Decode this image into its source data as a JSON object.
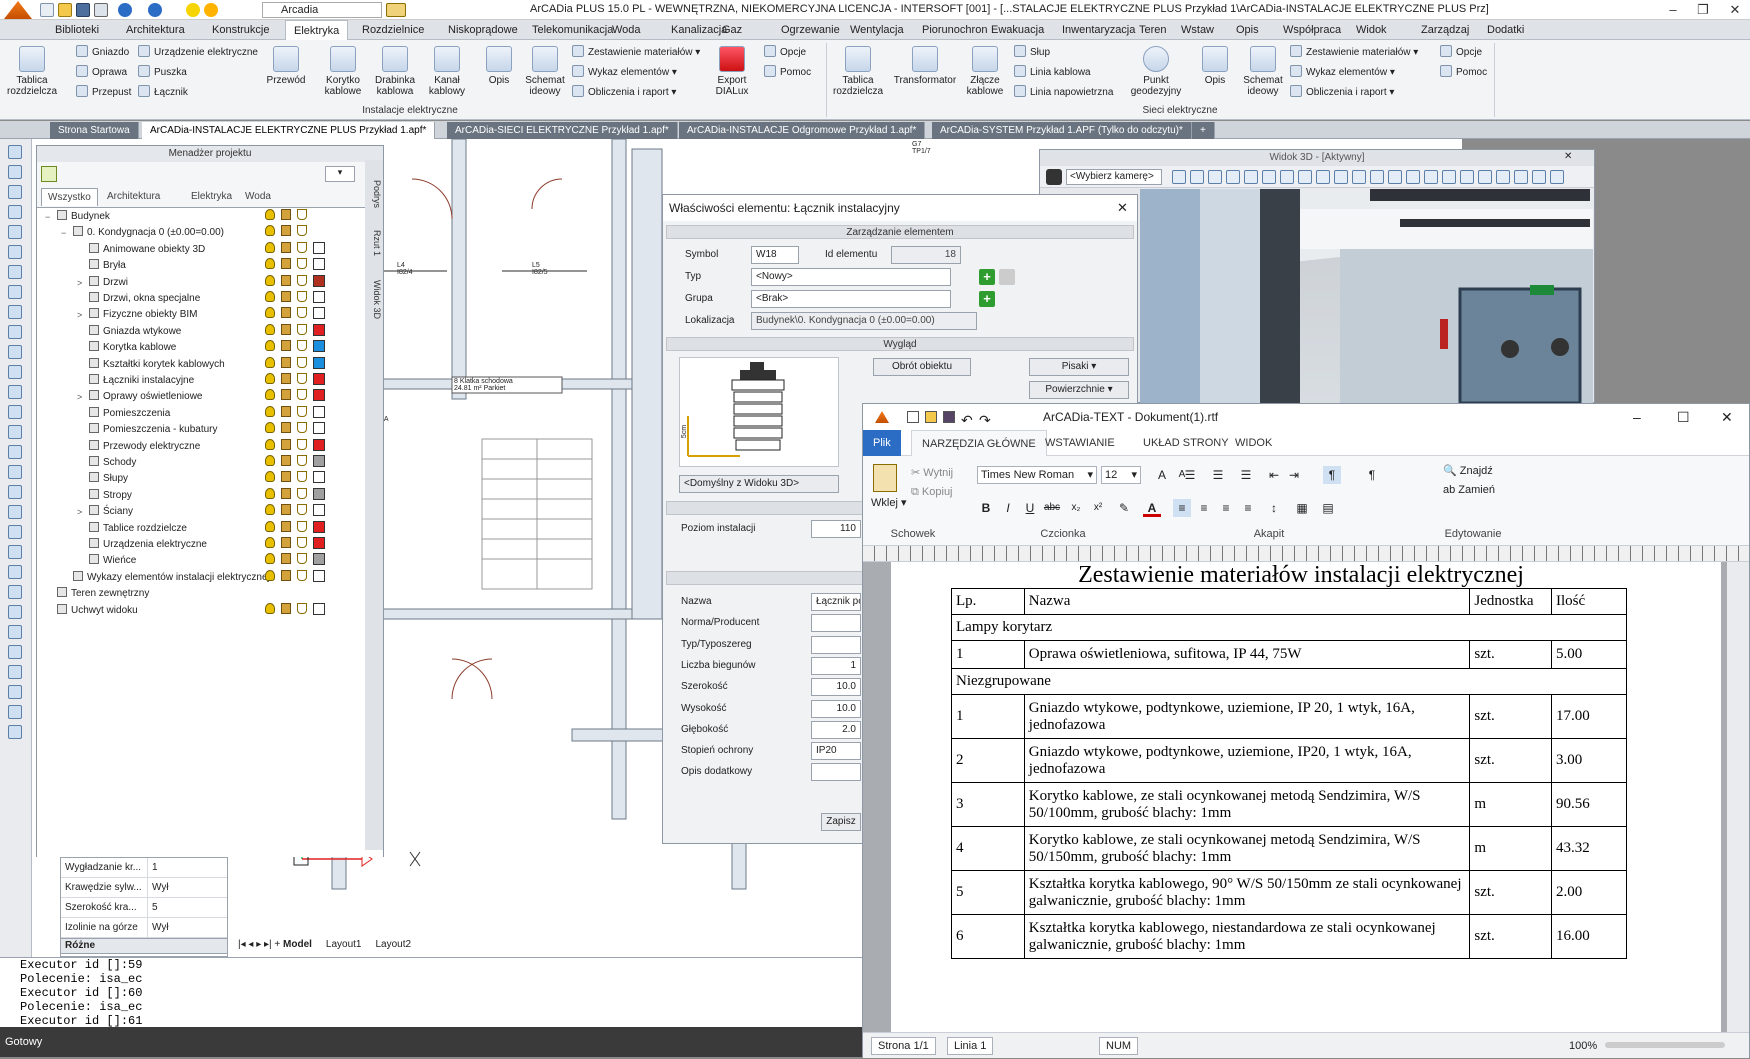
{
  "titlebar": {
    "title": "ArCADia PLUS 15.0 PL - WEWNĘTRZNA, NIEKOMERCYJNA LICENCJA - INTERSOFT [001] - [...STALACJE ELEKTRYCZNE PLUS Przykład 1\\ArCADia-INSTALACJE ELEKTRYCZNE PLUS Prz]",
    "layer_select": "Arcadia"
  },
  "menu": [
    "Biblioteki",
    "Architektura",
    "Konstrukcje",
    "Elektryka",
    "Rozdzielnice",
    "Niskoprądowe",
    "Telekomunikacja",
    "Woda",
    "Kanalizacja",
    "Gaz",
    "Ogrzewanie",
    "Wentylacja",
    "Piorunochron",
    "Ewakuacja",
    "Inwentaryzacja",
    "Teren",
    "Wstaw",
    "Opis",
    "Współpraca",
    "Widok",
    "Zarządzaj",
    "Dodatki"
  ],
  "menu_active": "Elektryka",
  "ribbon": {
    "tablica": "Tablica rozdzielcza",
    "gniazdo": "Gniazdo",
    "urzadzenie": "Urządzenie elektryczne",
    "oprawa": "Oprawa",
    "puszka": "Puszka",
    "przepust": "Przepust",
    "lacznik": "Łącznik",
    "przewod": "Przewód",
    "korytko": "Korytko kablowe",
    "drabinka": "Drabinka kablowa",
    "kanal": "Kanał kablowy",
    "opis": "Opis",
    "schemat": "Schemat ideowy",
    "zestawienie": "Zestawienie materiałów",
    "wykaz": "Wykaz elementów",
    "obliczenia": "Obliczenia i raport",
    "export": "Export DIALux",
    "opcje": "Opcje",
    "pomoc": "Pomoc",
    "group_instalacje": "Instalacje elektryczne",
    "tablica2": "Tablica rozdzielcza",
    "transformator": "Transformator",
    "zlacze": "Złącze kablowe",
    "slup": "Słup",
    "linia_kablowa": "Linia kablowa",
    "linia_napowietrzna": "Linia napowietrzna",
    "punkt": "Punkt geodezyjny",
    "opis2": "Opis",
    "schemat2": "Schemat ideowy",
    "zestawienie2": "Zestawienie materiałów",
    "wykaz2": "Wykaz elementów",
    "obliczenia2": "Obliczenia i raport",
    "opcje2": "Opcje",
    "pomoc2": "Pomoc",
    "group_sieci": "Sieci elektryczne"
  },
  "doc_tabs": [
    {
      "label": "Strona Startowa",
      "active": false
    },
    {
      "label": "ArCADia-INSTALACJE ELEKTRYCZNE PLUS Przykład 1.apf*",
      "active": true
    },
    {
      "label": "ArCADia-SIECI ELEKTRYCZNE Przykład 1.apf*",
      "active": false
    },
    {
      "label": "ArCADia-INSTALACJE Odgromowe Przykład 1.apf*",
      "active": false
    },
    {
      "label": "ArCADia-SYSTEM Przykład 1.APF (Tylko do odczytu)*",
      "active": false
    }
  ],
  "project_manager": {
    "title": "Menadżer projektu",
    "tabs": [
      "Wszystko",
      "Architektura",
      "Elektryka",
      "Woda"
    ],
    "side_tabs": [
      "Podrys",
      "Rzut 1",
      "Widok 3D"
    ],
    "tree": [
      {
        "label": "Budynek",
        "level": 0,
        "expand": "−",
        "color": ""
      },
      {
        "label": "0. Kondygnacja 0 (±0.00=0.00)",
        "level": 1,
        "expand": "−",
        "color": ""
      },
      {
        "label": "Animowane obiekty 3D",
        "level": 2,
        "expand": "",
        "color": "#ffffff"
      },
      {
        "label": "Bryła",
        "level": 2,
        "expand": "",
        "color": "#ffffff"
      },
      {
        "label": "Drzwi",
        "level": 2,
        "expand": ">",
        "color": "#b03020"
      },
      {
        "label": "Drzwi, okna specjalne",
        "level": 2,
        "expand": "",
        "color": "#ffffff"
      },
      {
        "label": "Fizyczne obiekty BIM",
        "level": 2,
        "expand": ">",
        "color": "#ffffff"
      },
      {
        "label": "Gniazda wtykowe",
        "level": 2,
        "expand": "",
        "color": "#e02020"
      },
      {
        "label": "Korytka kablowe",
        "level": 2,
        "expand": "",
        "color": "#1a8fe0"
      },
      {
        "label": "Kształtki korytek kablowych",
        "level": 2,
        "expand": "",
        "color": "#1a8fe0"
      },
      {
        "label": "Łączniki instalacyjne",
        "level": 2,
        "expand": "",
        "color": "#e02020"
      },
      {
        "label": "Oprawy oświetleniowe",
        "level": 2,
        "expand": ">",
        "color": "#e02020"
      },
      {
        "label": "Pomieszczenia",
        "level": 2,
        "expand": "",
        "color": "#ffffff"
      },
      {
        "label": "Pomieszczenia - kubatury",
        "level": 2,
        "expand": "",
        "color": "#ffffff"
      },
      {
        "label": "Przewody elektryczne",
        "level": 2,
        "expand": "",
        "color": "#e02020"
      },
      {
        "label": "Schody",
        "level": 2,
        "expand": "",
        "color": "#a0a0a0"
      },
      {
        "label": "Słupy",
        "level": 2,
        "expand": "",
        "color": "#ffffff"
      },
      {
        "label": "Stropy",
        "level": 2,
        "expand": "",
        "color": "#a0a0a0"
      },
      {
        "label": "Ściany",
        "level": 2,
        "expand": ">",
        "color": "#ffffff"
      },
      {
        "label": "Tablice rozdzielcze",
        "level": 2,
        "expand": "",
        "color": "#e02020"
      },
      {
        "label": "Urządzenia elektryczne",
        "level": 2,
        "expand": "",
        "color": "#e02020"
      },
      {
        "label": "Wieńce",
        "level": 2,
        "expand": "",
        "color": "#a0a0a0"
      },
      {
        "label": "Wykazy elementów instalacji elektrycznej",
        "level": 1,
        "expand": "",
        "color": "#ffffff"
      },
      {
        "label": "Teren zewnętrzny",
        "level": 0,
        "expand": "",
        "color": ""
      },
      {
        "label": "Uchwyt widoku",
        "level": 0,
        "expand": "",
        "color": "#ffffff"
      }
    ]
  },
  "left_props": [
    {
      "k": "Wygładzanie kr...",
      "v": "1"
    },
    {
      "k": "Krawędzie sylw...",
      "v": "Wył"
    },
    {
      "k": "Szerokość kra...",
      "v": "5"
    },
    {
      "k": "Izolinie na górze",
      "v": "Wył"
    }
  ],
  "left_props_footer": "Różne",
  "layout_tabs": [
    "Model",
    "Layout1",
    "Layout2"
  ],
  "command_line": [
    "Executor id []:59",
    "Polecenie: isa_ec",
    "Executor id []:60",
    "Polecenie: isa_ec",
    "Executor id []:61"
  ],
  "status": "Gotowy",
  "cad_labels": {
    "l4": "L4",
    "l4s": "I82/4",
    "l5": "L5",
    "l5s": "I82/5",
    "g7": "G7",
    "g7s": "TP1/7",
    "room_a": "Klatka schodowa",
    "room_b": "Parkiet",
    "room_area": "24.81 m²",
    "room_no": "8",
    "ma": "MA"
  },
  "view3d": {
    "title": "Widok 3D - [Aktywny]",
    "camera": "<Wybierz kamerę>"
  },
  "props": {
    "title": "Właściwości elementu: Łącznik instalacyjny",
    "sec_manage": "Zarządzanie elementem",
    "symbol_label": "Symbol",
    "symbol": "W18",
    "id_label": "Id elementu",
    "id": "18",
    "typ_label": "Typ",
    "typ": "<Nowy>",
    "grupa_label": "Grupa",
    "grupa": "<Brak>",
    "lok_label": "Lokalizacja",
    "lok": "Budynek\\0. Kondygnacja 0 (±0.00=0.00)",
    "sec_look": "Wygląd",
    "obrot": "Obrót obiektu",
    "pisaki": "Pisaki",
    "powierzchnie": "Powierzchnie",
    "preview_dim": "5cm",
    "view_select": "<Domyślny z Widoku 3D>",
    "sec_param": "Parametr",
    "poziom_label": "Poziom instalacji",
    "poziom": "110",
    "sec_param2": "Parametry t",
    "rows": [
      {
        "k": "Nazwa",
        "v": "Łącznik po"
      },
      {
        "k": "Norma/Producent",
        "v": ""
      },
      {
        "k": "Typ/Typoszereg",
        "v": ""
      },
      {
        "k": "Liczba biegunów",
        "v": "1"
      },
      {
        "k": "Szerokość",
        "v": "10.0"
      },
      {
        "k": "Wysokość",
        "v": "10.0"
      },
      {
        "k": "Głębokość",
        "v": "2.0"
      },
      {
        "k": "Stopień ochrony",
        "v": "IP20"
      },
      {
        "k": "Opis dodatkowy",
        "v": ""
      }
    ],
    "save": "Zapisz"
  },
  "text_app": {
    "title": "ArCADia-TEXT - Dokument(1).rtf",
    "tabs": [
      "Plik",
      "NARZĘDZIA GŁÓWNE",
      "WSTAWIANIE",
      "UKŁAD STRONY",
      "WIDOK"
    ],
    "cut": "Wytnij",
    "copy": "Kopiuj",
    "paste": "Wklej",
    "font": "Times New Roman",
    "size": "12",
    "find": "Znajdź",
    "replace": "Zamień",
    "groups": [
      "Schowek",
      "Czcionka",
      "Akapit",
      "Edytowanie"
    ],
    "doc_title": "Zestawienie materiałów instalacji elektrycznej",
    "table_header": [
      "Lp.",
      "Nazwa",
      "Jednostka",
      "Ilość"
    ],
    "table_rows": [
      {
        "group": "Lampy korytarz"
      },
      {
        "lp": "1",
        "name": "Oprawa oświetleniowa, sufitowa, IP 44, 75W",
        "unit": "szt.",
        "qty": "5.00"
      },
      {
        "group": "Niezgrupowane"
      },
      {
        "lp": "1",
        "name": "Gniazdo wtykowe, podtynkowe, uziemione, IP 20, 1 wtyk, 16A, jednofazowa",
        "unit": "szt.",
        "qty": "17.00"
      },
      {
        "lp": "2",
        "name": "Gniazdo wtykowe, podtynkowe, uziemione, IP20, 1 wtyk, 16A, jednofazowa",
        "unit": "szt.",
        "qty": "3.00"
      },
      {
        "lp": "3",
        "name": "Korytko kablowe, ze stali ocynkowanej metodą Sendzimira, W/S 50/100mm, grubość blachy: 1mm",
        "unit": "m",
        "qty": "90.56"
      },
      {
        "lp": "4",
        "name": "Korytko kablowe, ze stali ocynkowanej metodą Sendzimira, W/S 50/150mm, grubość blachy: 1mm",
        "unit": "m",
        "qty": "43.32"
      },
      {
        "lp": "5",
        "name": "Kształtka korytka kablowego, 90° W/S 50/150mm ze stali ocynkowanej galwanicznie, grubość blachy: 1mm",
        "unit": "szt.",
        "qty": "2.00"
      },
      {
        "lp": "6",
        "name": "Kształtka korytka kablowego, niestandardowa ze stali ocynkowanej galwanicznie, grubość blachy: 1mm",
        "unit": "szt.",
        "qty": "16.00"
      }
    ],
    "status_page": "Strona 1/1",
    "status_line": "Linia 1",
    "status_num": "NUM",
    "zoom": "100%"
  }
}
